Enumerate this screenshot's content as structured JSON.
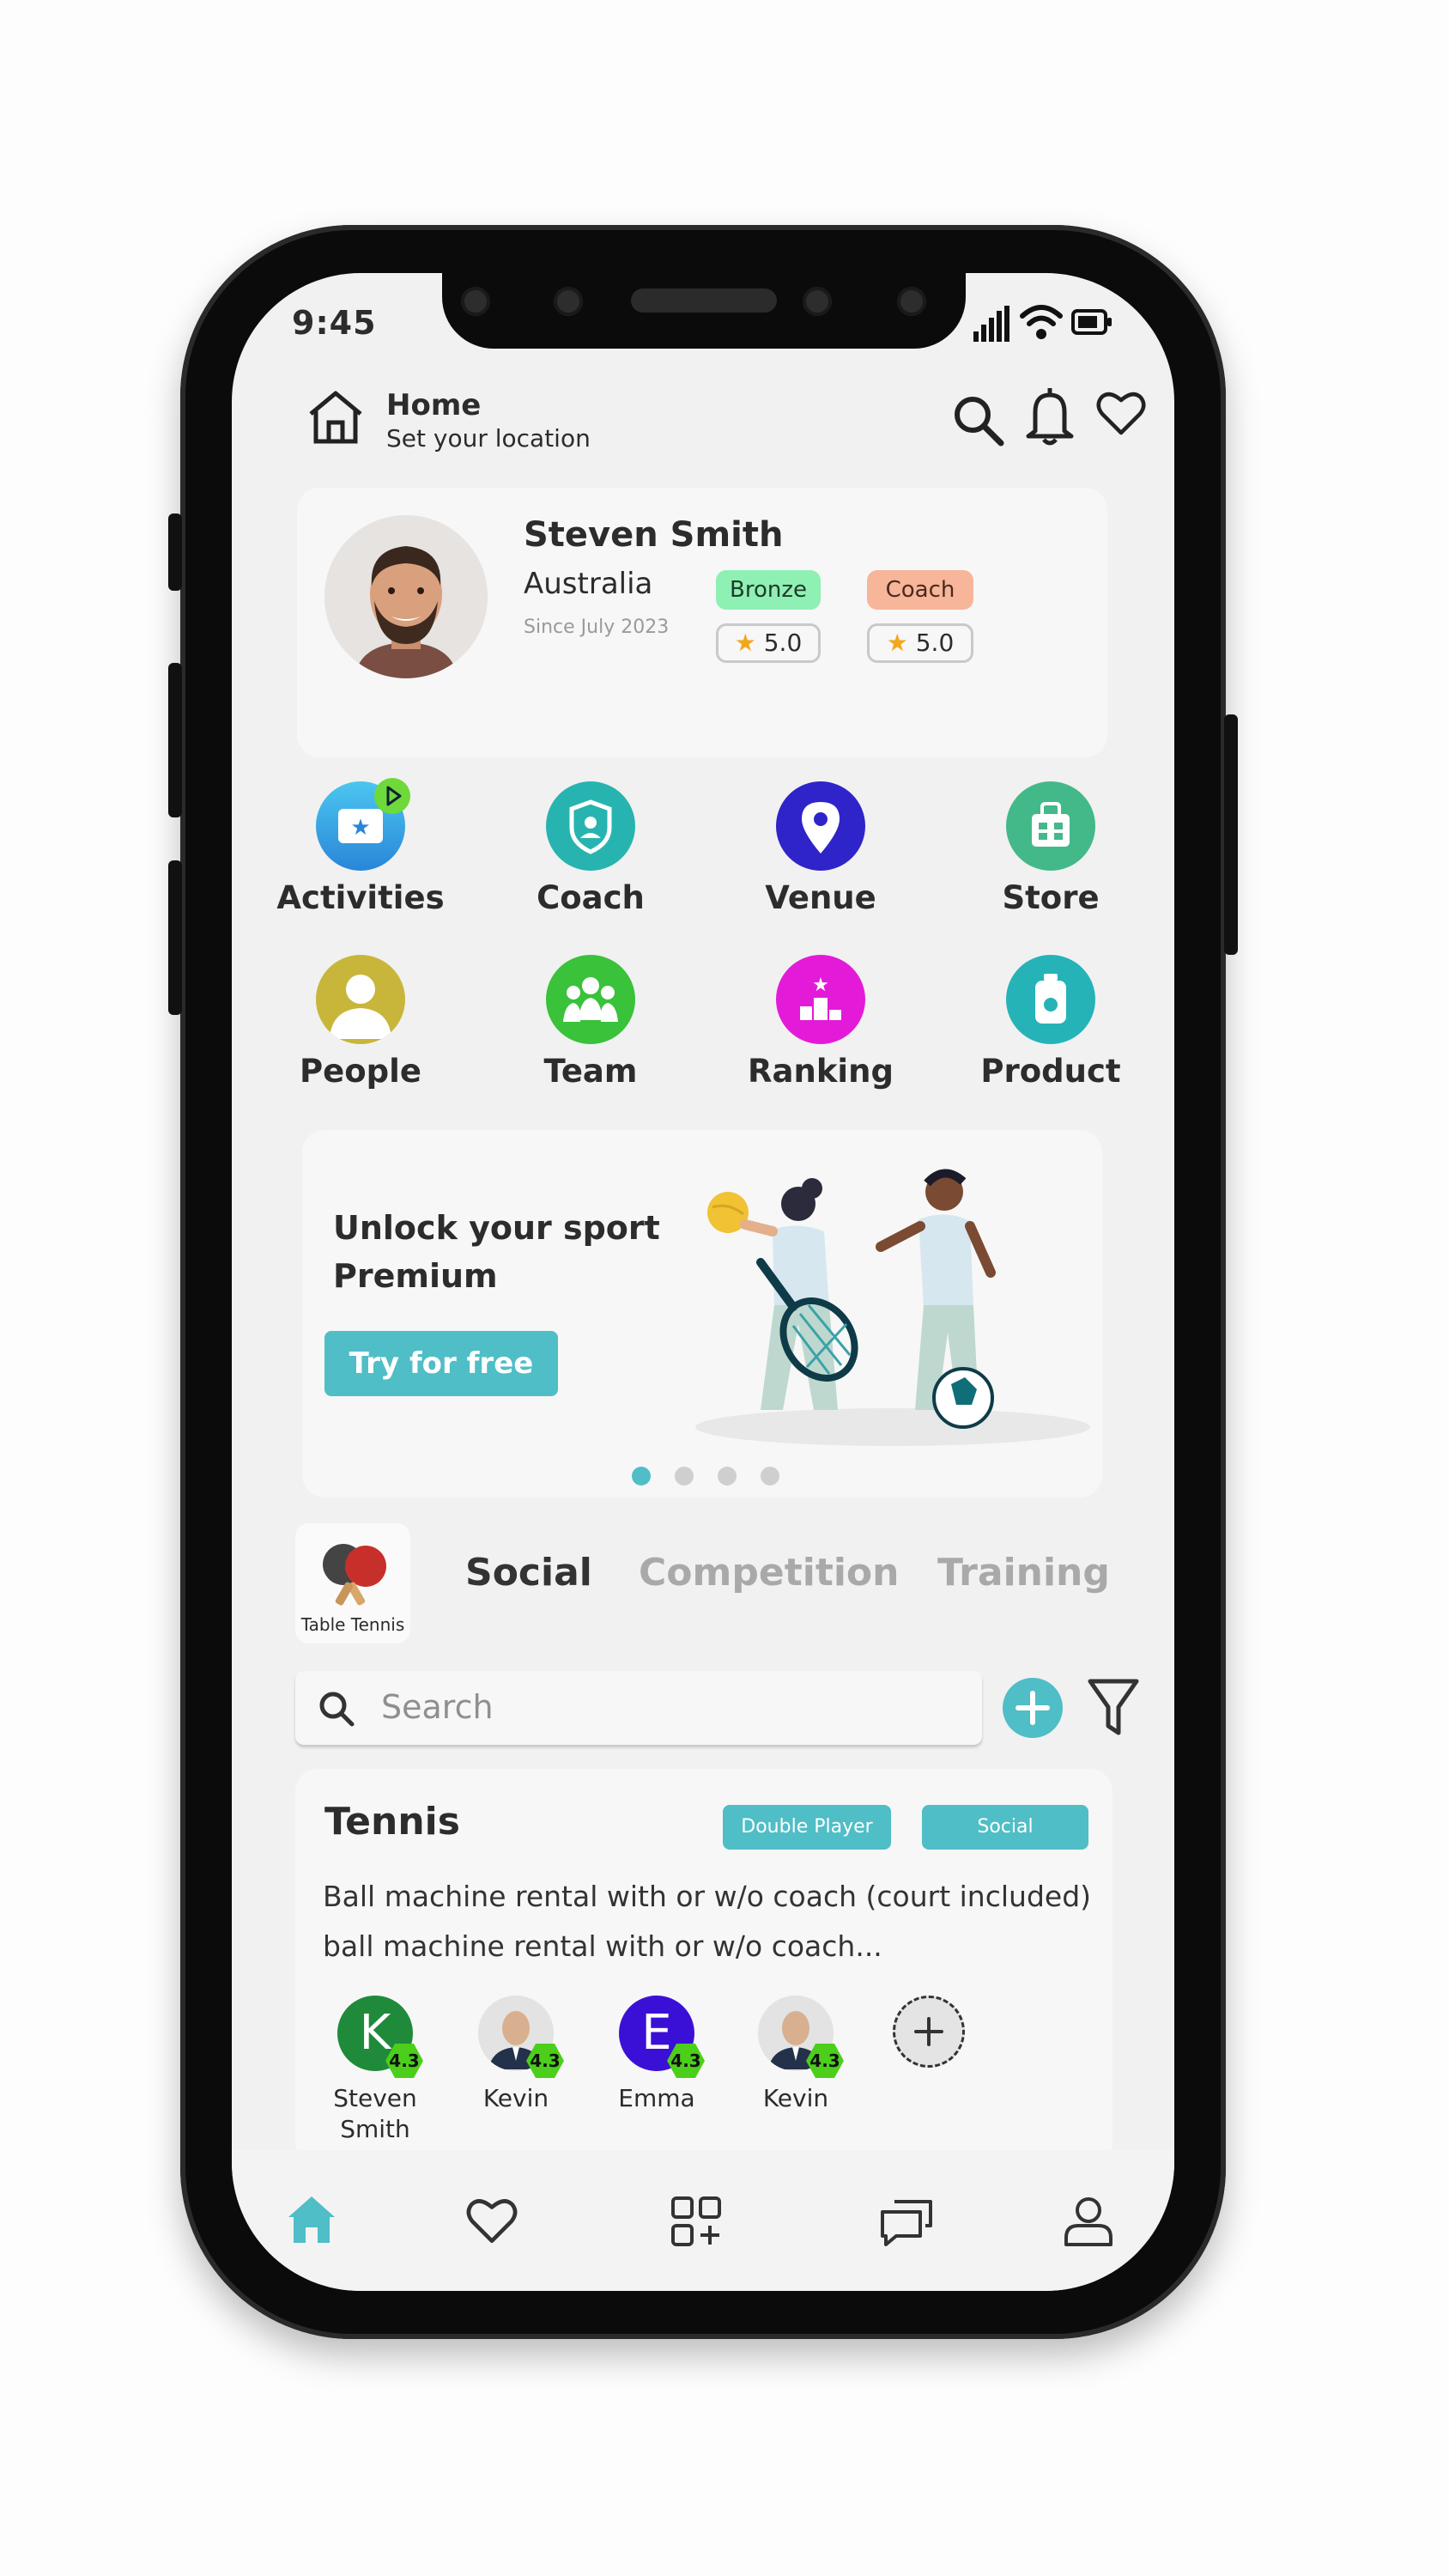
{
  "status": {
    "time": "9:45"
  },
  "header": {
    "title": "Home",
    "subtitle": "Set your location"
  },
  "profile": {
    "name": "Steven Smith",
    "country": "Australia",
    "since": "Since July 2023",
    "roles": [
      {
        "label": "Bronze",
        "rating": "5.0"
      },
      {
        "label": "Coach",
        "rating": "5.0"
      }
    ]
  },
  "categories": [
    {
      "label": "Activities",
      "icon": "ticket-icon",
      "color": "#3aa8e6"
    },
    {
      "label": "Coach",
      "icon": "shield-icon",
      "color": "#27b4b0"
    },
    {
      "label": "Venue",
      "icon": "location-pin-icon",
      "color": "#2f24c9"
    },
    {
      "label": "Store",
      "icon": "shop-icon",
      "color": "#43b98a"
    },
    {
      "label": "People",
      "icon": "person-icon",
      "color": "#c8b63a"
    },
    {
      "label": "Team",
      "icon": "group-icon",
      "color": "#39c23a"
    },
    {
      "label": "Ranking",
      "icon": "podium-icon",
      "color": "#e31bd8"
    },
    {
      "label": "Product",
      "icon": "bottle-icon",
      "color": "#25b3b8"
    }
  ],
  "banner": {
    "title_line1": "Unlock your sport",
    "title_line2": "Premium",
    "cta": "Try for free"
  },
  "sport_filter": {
    "label": "Table Tennis"
  },
  "tabs": [
    "Social",
    "Competition",
    "Training"
  ],
  "search": {
    "placeholder": "Search"
  },
  "activity": {
    "title": "Tennis",
    "tags": [
      "Double Player",
      "Social"
    ],
    "description_line1": "Ball machine rental with or w/o coach (court included)",
    "description_line2": "ball machine rental with or w/o coach...",
    "members": [
      {
        "name_line1": "Steven",
        "name_line2": "Smith",
        "initial": "K",
        "rating": "4.3"
      },
      {
        "name_line1": "Kevin",
        "name_line2": "",
        "initial": "",
        "rating": "4.3"
      },
      {
        "name_line1": "Emma",
        "name_line2": "",
        "initial": "E",
        "rating": "4.3"
      },
      {
        "name_line1": "Kevin",
        "name_line2": "",
        "initial": "",
        "rating": "4.3"
      }
    ]
  },
  "colors": {
    "accent": "#4fbec6",
    "bronze": "#8ff0b4",
    "coach": "#f7b59a"
  },
  "bottom_nav": [
    "home-icon",
    "heart-icon",
    "apps-add-icon",
    "chat-icon",
    "profile-icon"
  ]
}
